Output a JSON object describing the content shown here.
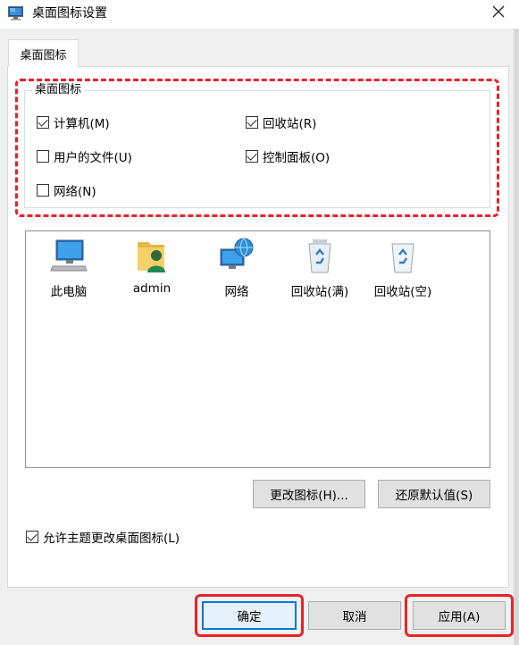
{
  "window": {
    "title": "桌面图标设置",
    "close_glyph": "✕"
  },
  "tabs": [
    {
      "label": "桌面图标"
    }
  ],
  "group": {
    "legend": "桌面图标",
    "checkboxes": [
      {
        "label": "计算机(M)",
        "checked": true
      },
      {
        "label": "回收站(R)",
        "checked": true
      },
      {
        "label": "用户的文件(U)",
        "checked": false
      },
      {
        "label": "控制面板(O)",
        "checked": true
      },
      {
        "label": "网络(N)",
        "checked": false
      }
    ]
  },
  "icons": [
    {
      "label": "此电脑",
      "icon": "computer-icon"
    },
    {
      "label": "admin",
      "icon": "user-folder-icon"
    },
    {
      "label": "网络",
      "icon": "network-icon"
    },
    {
      "label": "回收站(满)",
      "icon": "recycle-bin-full-icon"
    },
    {
      "label": "回收站(空)",
      "icon": "recycle-bin-empty-icon"
    }
  ],
  "buttons": {
    "change_icon": "更改图标(H)...",
    "restore_default": "还原默认值(S)",
    "ok": "确定",
    "cancel": "取消",
    "apply": "应用(A)"
  },
  "allow_themes": {
    "label": "允许主题更改桌面图标(L)",
    "checked": true
  },
  "colors": {
    "annotation_red": "#e8232a",
    "default_button_border": "#0078d7"
  }
}
